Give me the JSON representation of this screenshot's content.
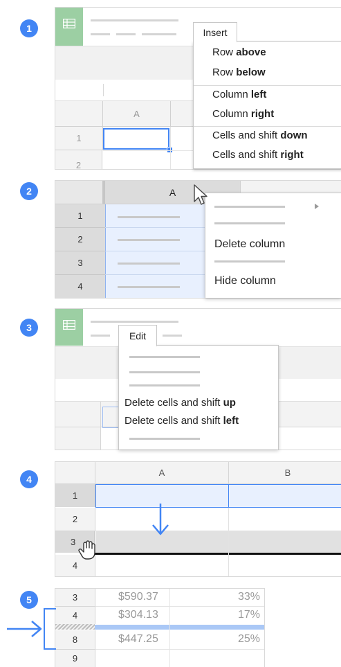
{
  "steps": [
    "1",
    "2",
    "3",
    "4",
    "5"
  ],
  "colors": {
    "accent": "#4285f4",
    "selection": "#e8f0fe",
    "sheets_green": "#9ccfa3"
  },
  "panel1": {
    "column_header": "A",
    "row_numbers": [
      "1",
      "2"
    ],
    "menu_tab": "Insert",
    "menu_items": [
      {
        "prefix": "Row ",
        "bold": "above"
      },
      {
        "prefix": "Row ",
        "bold": "below"
      },
      {
        "prefix": "Column ",
        "bold": "left"
      },
      {
        "prefix": "Column ",
        "bold": "right"
      },
      {
        "prefix": "Cells and shift ",
        "bold": "down"
      },
      {
        "prefix": "Cells and shift ",
        "bold": "right"
      }
    ]
  },
  "panel2": {
    "column_header": "A",
    "row_numbers": [
      "1",
      "2",
      "3",
      "4"
    ],
    "menu_items": [
      "Delete column",
      "Hide column"
    ]
  },
  "panel3": {
    "menu_tab": "Edit",
    "menu_items": [
      {
        "prefix": "Delete cells and shift ",
        "bold": "up"
      },
      {
        "prefix": "Delete cells and shift ",
        "bold": "left"
      }
    ]
  },
  "panel4": {
    "column_headers": [
      "A",
      "B"
    ],
    "row_numbers": [
      "1",
      "2",
      "3",
      "4"
    ]
  },
  "panel5": {
    "rows": [
      {
        "num": "3",
        "amount": "$590.37",
        "percent": "33%"
      },
      {
        "num": "4",
        "amount": "$304.13",
        "percent": "17%"
      },
      {
        "num": "8",
        "amount": "$447.25",
        "percent": "25%"
      },
      {
        "num": "9",
        "amount": "",
        "percent": ""
      }
    ]
  }
}
